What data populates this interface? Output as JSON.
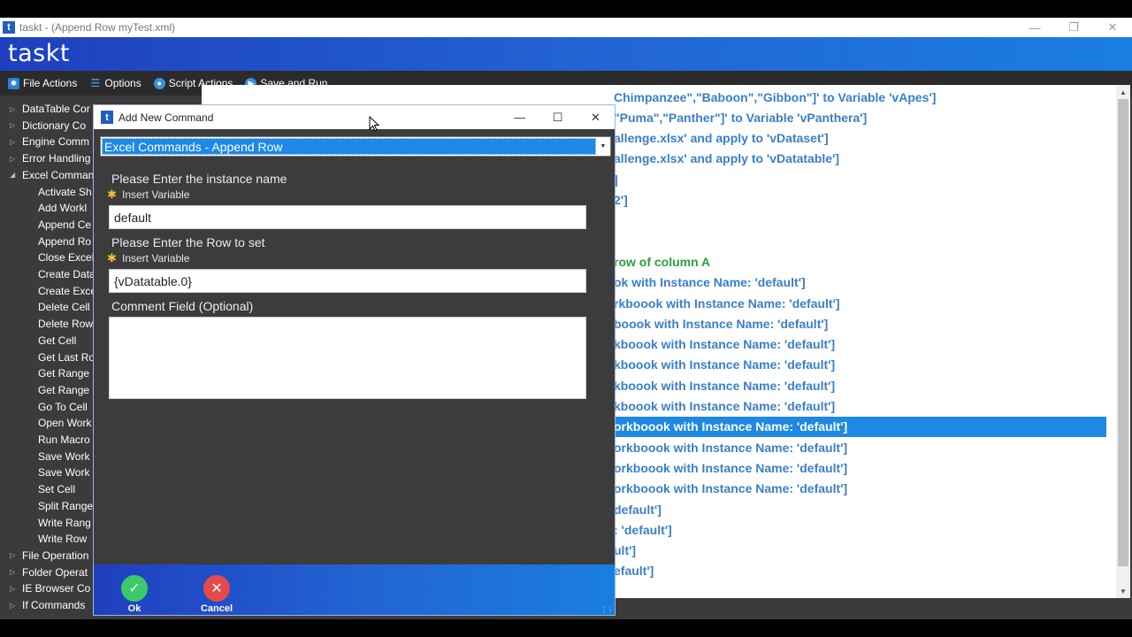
{
  "window": {
    "title": "taskt - (Append Row myTest.xml)",
    "brand": "taskt",
    "logo_letter": "t"
  },
  "menu": [
    {
      "label": "File Actions",
      "icon": "star-icon"
    },
    {
      "label": "Options",
      "icon": "list-icon"
    },
    {
      "label": "Script Actions",
      "icon": "gear-icon"
    },
    {
      "label": "Save and Run",
      "icon": "play-icon"
    }
  ],
  "sidebar": {
    "items": [
      {
        "label": "DataTable Cor",
        "level": 0,
        "expanded": false
      },
      {
        "label": "Dictionary Co",
        "level": 0,
        "expanded": false
      },
      {
        "label": "Engine Comm",
        "level": 0,
        "expanded": false
      },
      {
        "label": "Error Handling",
        "level": 0,
        "expanded": false
      },
      {
        "label": "Excel Comman",
        "level": 0,
        "expanded": true
      },
      {
        "label": "Activate Sh",
        "level": 1
      },
      {
        "label": "Add Workl",
        "level": 1
      },
      {
        "label": "Append Ce",
        "level": 1
      },
      {
        "label": "Append Ro",
        "level": 1
      },
      {
        "label": "Close Excel",
        "level": 1
      },
      {
        "label": "Create Data",
        "level": 1
      },
      {
        "label": "Create Exce",
        "level": 1
      },
      {
        "label": "Delete Cell",
        "level": 1
      },
      {
        "label": "Delete Row",
        "level": 1
      },
      {
        "label": "Get Cell",
        "level": 1
      },
      {
        "label": "Get Last Ro",
        "level": 1
      },
      {
        "label": "Get Range",
        "level": 1
      },
      {
        "label": "Get Range",
        "level": 1
      },
      {
        "label": "Go To Cell",
        "level": 1
      },
      {
        "label": "Open Work",
        "level": 1
      },
      {
        "label": "Run Macro",
        "level": 1
      },
      {
        "label": "Save Work",
        "level": 1
      },
      {
        "label": "Save Work",
        "level": 1
      },
      {
        "label": "Set Cell",
        "level": 1
      },
      {
        "label": "Split Range",
        "level": 1
      },
      {
        "label": "Write Rang",
        "level": 1
      },
      {
        "label": "Write Row",
        "level": 1
      },
      {
        "label": "File Operation",
        "level": 0,
        "expanded": false
      },
      {
        "label": "Folder Operat",
        "level": 0,
        "expanded": false
      },
      {
        "label": "IE Browser Co",
        "level": 0,
        "expanded": false
      },
      {
        "label": "If Commands",
        "level": 0,
        "expanded": false
      }
    ]
  },
  "script_rows": [
    {
      "text": "Chimpanzee\",\"Baboon\",\"Gibbon\"]' to Variable 'vApes']",
      "style": "blue"
    },
    {
      "text": "\"Puma\",\"Panther\"]' to Variable 'vPanthera']",
      "style": "blue"
    },
    {
      "text": "allenge.xlsx' and apply to 'vDataset']",
      "style": "blue"
    },
    {
      "text": "allenge.xlsx' and apply to 'vDatatable']",
      "style": "blue"
    },
    {
      "text": "]",
      "style": "blue"
    },
    {
      "text": "2']",
      "style": "blue"
    },
    {
      "text": "",
      "style": "blue"
    },
    {
      "text": "",
      "style": "blue"
    },
    {
      "text": "row of column A",
      "style": "green"
    },
    {
      "text": "ok with Instance Name: 'default']",
      "style": "blue"
    },
    {
      "text": "rkboook with Instance Name: 'default']",
      "style": "blue"
    },
    {
      "text": "boook with Instance Name: 'default']",
      "style": "blue"
    },
    {
      "text": "kboook with Instance Name: 'default']",
      "style": "blue"
    },
    {
      "text": "kboook with Instance Name: 'default']",
      "style": "blue"
    },
    {
      "text": "kboook with Instance Name: 'default']",
      "style": "blue"
    },
    {
      "text": "kboook with Instance Name: 'default']",
      "style": "blue"
    },
    {
      "text": "orkboook with Instance Name: 'default']",
      "style": "selected"
    },
    {
      "text": "orkboook with Instance Name: 'default']",
      "style": "blue"
    },
    {
      "text": "orkboook with Instance Name: 'default']",
      "style": "blue"
    },
    {
      "text": "orkboook with Instance Name: 'default']",
      "style": "blue"
    },
    {
      "text": "default']",
      "style": "blue"
    },
    {
      "text": ": 'default']",
      "style": "blue"
    },
    {
      "text": "ult']",
      "style": "blue"
    },
    {
      "text": "efault']",
      "style": "blue"
    }
  ],
  "dialog": {
    "title": "Add New Command",
    "selected_command": "Excel Commands - Append Row",
    "instance_label": "Please Enter the instance name",
    "insert_variable": "Insert Variable",
    "instance_value": "default",
    "row_label": "Please Enter the Row to set",
    "row_value": "{vDatatable.0}",
    "comment_label": "Comment Field (Optional)",
    "comment_value": "",
    "ok_label": "Ok",
    "cancel_label": "Cancel"
  },
  "colors": {
    "accent": "#1e88e5",
    "script_text": "#3a7fc7",
    "comment_text": "#2e9f3a",
    "ok": "#3cc96a",
    "cancel": "#e44a4a"
  }
}
